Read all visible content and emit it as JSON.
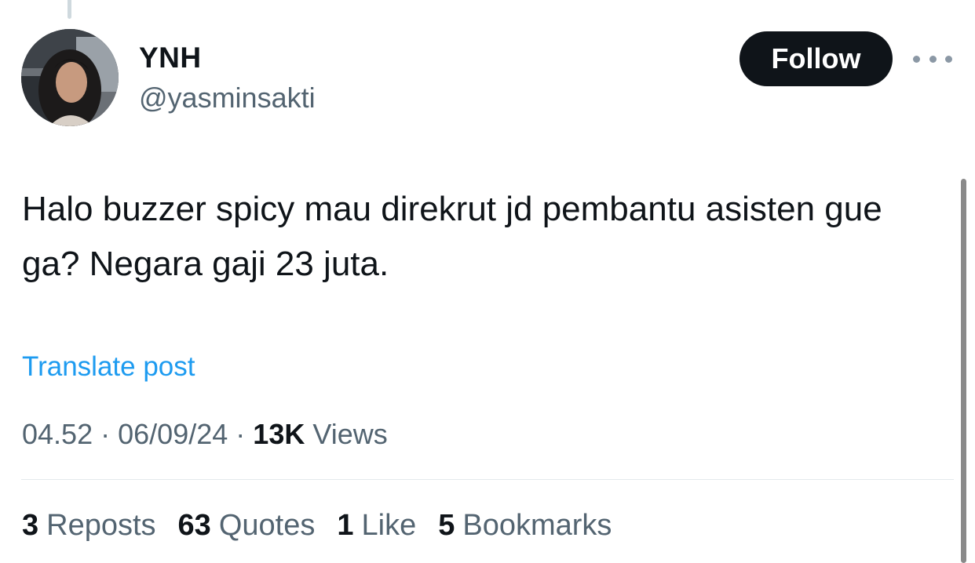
{
  "author": {
    "display_name": "YNH",
    "handle": "@yasminsakti",
    "avatar_icon": "profile-photo"
  },
  "actions": {
    "follow_label": "Follow",
    "more_icon": "ellipsis-horizontal"
  },
  "post": {
    "text": "Halo buzzer spicy mau direkrut jd pembantu asisten gue ga? Negara gaji 23 juta.",
    "translate_label": "Translate post"
  },
  "meta": {
    "time": "04.52",
    "separator": "·",
    "date": "06/09/24",
    "views_count": "13K",
    "views_label": "Views"
  },
  "stats": {
    "reposts_count": "3",
    "reposts_label": "Reposts",
    "quotes_count": "63",
    "quotes_label": "Quotes",
    "likes_count": "1",
    "likes_label": "Like",
    "bookmarks_count": "5",
    "bookmarks_label": "Bookmarks"
  },
  "colors": {
    "text_primary": "#0f1419",
    "text_secondary": "#536471",
    "link": "#1d9bf0",
    "follow_bg": "#0f1419"
  }
}
